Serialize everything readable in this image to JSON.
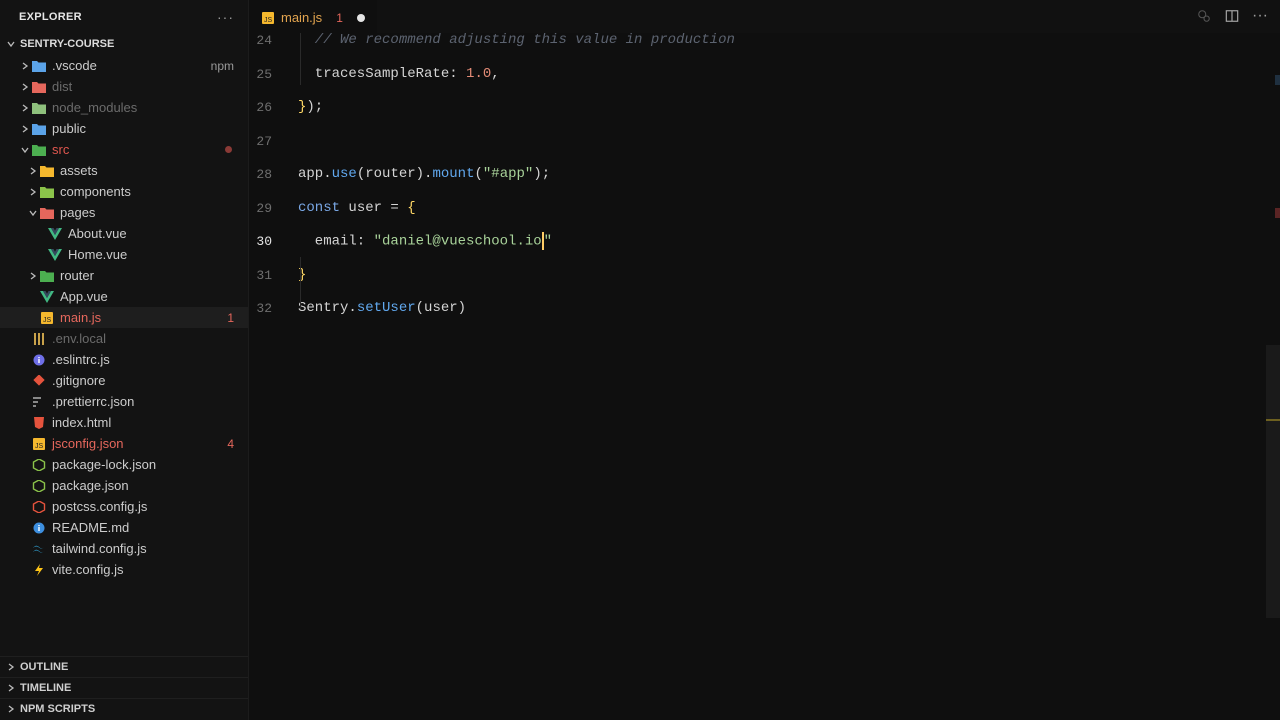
{
  "explorer": {
    "title": "EXPLORER",
    "more": "···",
    "project": "SENTRY-COURSE",
    "items": [
      {
        "label": ".vscode",
        "badge": "npm",
        "icon": "vscode-folder-icon",
        "color": "#5ba3e8",
        "style": "normal"
      },
      {
        "label": "dist",
        "badge": "",
        "icon": "dist-folder-icon",
        "color": "#e5675c",
        "style": "dim"
      },
      {
        "label": "node_modules",
        "badge": "",
        "icon": "node-folder-icon",
        "color": "#8ec07c",
        "style": "dim"
      },
      {
        "label": "public",
        "badge": "",
        "icon": "public-folder-icon",
        "color": "#5ba3e8",
        "style": "normal"
      },
      {
        "label": "src",
        "badge": "",
        "icon": "src-folder-icon",
        "color": "#4caf50",
        "style": "red"
      },
      {
        "label": "assets",
        "badge": "",
        "icon": "assets-folder-icon",
        "color": "#f5b82e",
        "style": "normal"
      },
      {
        "label": "components",
        "badge": "",
        "icon": "components-folder-icon",
        "color": "#8bc34a",
        "style": "normal"
      },
      {
        "label": "pages",
        "badge": "",
        "icon": "pages-folder-icon",
        "color": "#e5675c",
        "style": "normal"
      },
      {
        "label": "About.vue",
        "badge": "",
        "icon": "vue-icon",
        "color": "#41b883",
        "style": "normal"
      },
      {
        "label": "Home.vue",
        "badge": "",
        "icon": "vue-icon",
        "color": "#41b883",
        "style": "normal"
      },
      {
        "label": "router",
        "badge": "",
        "icon": "router-folder-icon",
        "color": "#4caf50",
        "style": "normal"
      },
      {
        "label": "App.vue",
        "badge": "",
        "icon": "vue-icon",
        "color": "#41b883",
        "style": "normal"
      },
      {
        "label": "main.js",
        "badge": "1",
        "icon": "js-icon",
        "color": "#f5b82e",
        "style": "redl"
      },
      {
        "label": ".env.local",
        "badge": "",
        "icon": "env-icon",
        "color": "#c9a24a",
        "style": "dim"
      },
      {
        "label": ".eslintrc.js",
        "badge": "",
        "icon": "eslint-icon",
        "color": "#6f6fe8",
        "style": "normal"
      },
      {
        "label": ".gitignore",
        "badge": "",
        "icon": "git-icon",
        "color": "#e5533d",
        "style": "normal"
      },
      {
        "label": ".prettierrc.json",
        "badge": "",
        "icon": "prettier-icon",
        "color": "#888888",
        "style": "normal"
      },
      {
        "label": "index.html",
        "badge": "",
        "icon": "html-icon",
        "color": "#e5533d",
        "style": "normal"
      },
      {
        "label": "jsconfig.json",
        "badge": "4",
        "icon": "jsconfig-icon",
        "color": "#f5b82e",
        "style": "redl"
      },
      {
        "label": "package-lock.json",
        "badge": "",
        "icon": "npm-icon",
        "color": "#8bc34a",
        "style": "normal"
      },
      {
        "label": "package.json",
        "badge": "",
        "icon": "npm-icon",
        "color": "#8bc34a",
        "style": "normal"
      },
      {
        "label": "postcss.config.js",
        "badge": "",
        "icon": "postcss-icon",
        "color": "#e5533d",
        "style": "normal"
      },
      {
        "label": "README.md",
        "badge": "",
        "icon": "info-icon",
        "color": "#3d8fe0",
        "style": "normal"
      },
      {
        "label": "tailwind.config.js",
        "badge": "",
        "icon": "tailwind-icon",
        "color": "#38bdf8",
        "style": "normal"
      },
      {
        "label": "vite.config.js",
        "badge": "",
        "icon": "vite-icon",
        "color": "#ffc517",
        "style": "normal"
      }
    ],
    "panels": [
      "OUTLINE",
      "TIMELINE",
      "NPM SCRIPTS"
    ]
  },
  "tab": {
    "label": "main.js",
    "errors": "1"
  },
  "editor": {
    "lines": [
      {
        "num": "24",
        "tokens": [
          {
            "t": "  // We recommend adjusting this value in production",
            "c": "k-cm"
          }
        ]
      },
      {
        "num": "25",
        "tokens": [
          {
            "t": "  tracesSampleRate",
            "c": "k-p"
          },
          {
            "t": ": ",
            "c": "k-p"
          },
          {
            "t": "1.0",
            "c": "k-num"
          },
          {
            "t": ",",
            "c": "k-p"
          }
        ]
      },
      {
        "num": "26",
        "tokens": [
          {
            "t": "}",
            "c": "k-br"
          },
          {
            "t": ");",
            "c": "k-p"
          }
        ]
      },
      {
        "num": "27",
        "tokens": []
      },
      {
        "num": "28",
        "tokens": [
          {
            "t": "app",
            "c": "k-p"
          },
          {
            "t": ".",
            "c": "k-p"
          },
          {
            "t": "use",
            "c": "k-fn"
          },
          {
            "t": "(router).",
            "c": "k-p"
          },
          {
            "t": "mount",
            "c": "k-fn"
          },
          {
            "t": "(",
            "c": "k-p"
          },
          {
            "t": "\"#app\"",
            "c": "k-str"
          },
          {
            "t": ");",
            "c": "k-p"
          }
        ]
      },
      {
        "num": "29",
        "tokens": [
          {
            "t": "const",
            "c": "k-kw"
          },
          {
            "t": " user = ",
            "c": "k-p"
          },
          {
            "t": "{",
            "c": "k-br"
          }
        ]
      },
      {
        "num": "30",
        "tokens": [
          {
            "t": "  email: ",
            "c": "k-p"
          },
          {
            "t": "\"daniel@vueschool.io",
            "c": "k-str"
          },
          {
            "t": "CARET",
            "c": "caret"
          },
          {
            "t": "\"",
            "c": "k-str"
          }
        ]
      },
      {
        "num": "31",
        "tokens": [
          {
            "t": "}",
            "c": "k-br"
          }
        ]
      },
      {
        "num": "32",
        "tokens": [
          {
            "t": "Sentry",
            "c": "k-p"
          },
          {
            "t": ".",
            "c": "k-p"
          },
          {
            "t": "setUser",
            "c": "k-fn"
          },
          {
            "t": "(user)",
            "c": "k-p"
          }
        ]
      }
    ],
    "current_line": "30"
  }
}
